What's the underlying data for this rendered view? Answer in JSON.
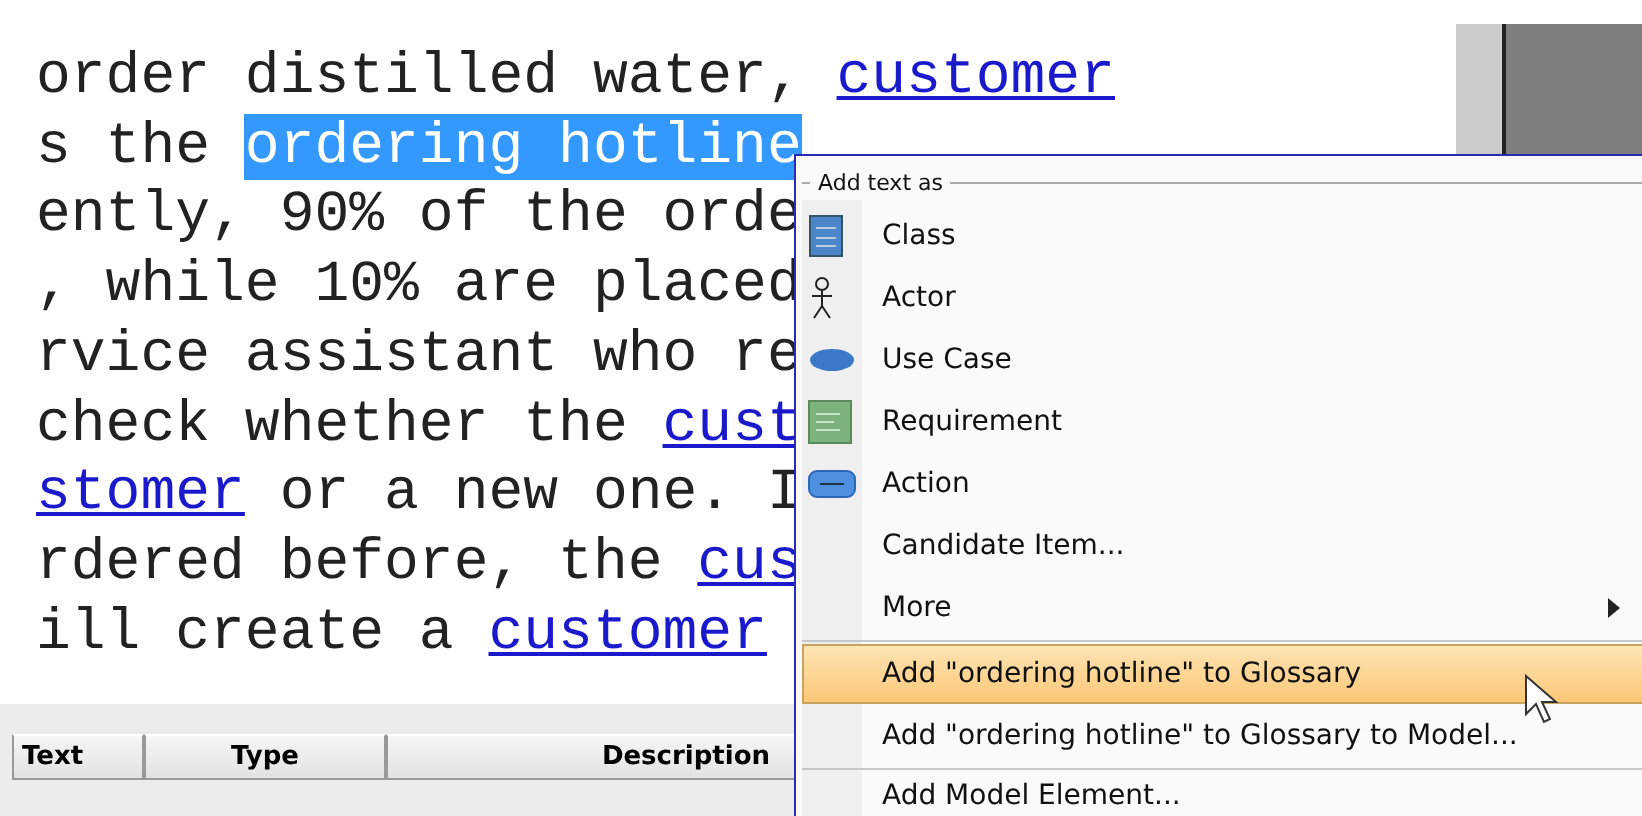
{
  "editor": {
    "lines": [
      [
        {
          "kind": "plain",
          "text": "order distilled water, "
        },
        {
          "kind": "link",
          "text": "customer"
        }
      ],
      [
        {
          "kind": "plain",
          "text": "s the "
        },
        {
          "kind": "selected",
          "text": "ordering hotline"
        }
      ],
      [
        {
          "kind": "plain",
          "text": "ently, 90% of the orde"
        }
      ],
      [
        {
          "kind": "plain",
          "text": ", while 10% are placed"
        }
      ],
      [
        {
          "kind": "plain",
          "text": "rvice assistant who re"
        }
      ],
      [
        {
          "kind": "plain",
          "text": "check whether the "
        },
        {
          "kind": "link",
          "text": "cust"
        }
      ],
      [
        {
          "kind": "link",
          "text": "stomer"
        },
        {
          "kind": "plain",
          "text": " or a new one. I"
        }
      ],
      [
        {
          "kind": "plain",
          "text": "rdered before, the "
        },
        {
          "kind": "link",
          "text": "cus"
        }
      ],
      [
        {
          "kind": "plain",
          "text": "ill create a "
        },
        {
          "kind": "link",
          "text": "customer"
        }
      ]
    ]
  },
  "table": {
    "columns": [
      "Text",
      "Type",
      "Description"
    ]
  },
  "menu": {
    "header": "Add text as",
    "items": [
      {
        "kind": "class",
        "label": "Class",
        "selected": false
      },
      {
        "kind": "actor",
        "label": "Actor",
        "selected": false
      },
      {
        "kind": "use-case",
        "label": "Use Case",
        "selected": false
      },
      {
        "kind": "requirement",
        "label": "Requirement",
        "selected": false
      },
      {
        "kind": "action",
        "label": "Action",
        "selected": false
      },
      {
        "kind": "item",
        "label": "Candidate Item...",
        "selected": false
      },
      {
        "kind": "submenu",
        "label": "More",
        "selected": false
      },
      {
        "kind": "separator"
      },
      {
        "kind": "item",
        "label": "Add \"ordering hotline\" to Glossary",
        "selected": true
      },
      {
        "kind": "item",
        "label": "Add \"ordering hotline\" to Glossary to Model...",
        "selected": false
      },
      {
        "kind": "separator"
      },
      {
        "kind": "item",
        "label": "Add Model Element...",
        "selected": false
      }
    ]
  }
}
